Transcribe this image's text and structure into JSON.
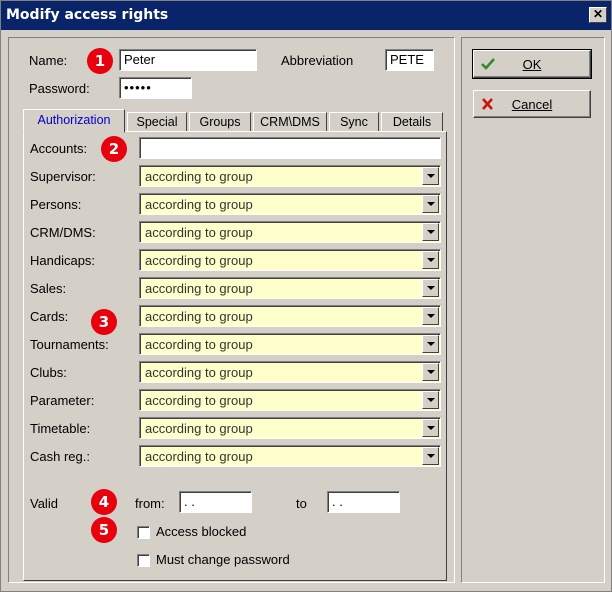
{
  "window": {
    "title": "Modify access rights",
    "close_glyph": "✕"
  },
  "header": {
    "name_label": "Name:",
    "name_value": "Peter",
    "abbreviation_label": "Abbreviation",
    "abbreviation_value": "PETE",
    "password_label": "Password:",
    "password_value": "•••••"
  },
  "tabs": [
    "Authorization",
    "Special",
    "Groups",
    "CRM\\DMS",
    "Sync",
    "Details"
  ],
  "active_tab": "Authorization",
  "authorization": {
    "accounts_label": "Accounts:",
    "accounts_value": "",
    "rows": [
      {
        "label": "Supervisor:",
        "value": "according to group"
      },
      {
        "label": "Persons:",
        "value": "according to group"
      },
      {
        "label": "CRM/DMS:",
        "value": "according to group"
      },
      {
        "label": "Handicaps:",
        "value": "according to group"
      },
      {
        "label": "Sales:",
        "value": "according to group"
      },
      {
        "label": "Cards:",
        "value": "according to group"
      },
      {
        "label": "Tournaments:",
        "value": "according to group"
      },
      {
        "label": "Clubs:",
        "value": "according to group"
      },
      {
        "label": "Parameter:",
        "value": "according to group"
      },
      {
        "label": "Timetable:",
        "value": "according to group"
      },
      {
        "label": "Cash reg.:",
        "value": "according to group"
      }
    ],
    "valid_label": "Valid",
    "from_label": "from:",
    "from_value": ". .",
    "to_label": "to",
    "to_value": ". .",
    "access_blocked_label": "Access blocked",
    "access_blocked_checked": false,
    "must_change_password_label": "Must change password",
    "must_change_password_checked": false
  },
  "badges": [
    "1",
    "2",
    "3",
    "4",
    "5"
  ],
  "buttons": {
    "ok_label": "OK",
    "ok_icon": "check-icon",
    "cancel_label": "Cancel",
    "cancel_icon": "cross-icon"
  },
  "colors": {
    "title_bar": "#0a246a",
    "badge": "#e8000d",
    "combo_bg": "#ffffcc",
    "active_tab_text": "#0000cc",
    "check_green": "#2e8b2e",
    "cross_red": "#d01010"
  }
}
